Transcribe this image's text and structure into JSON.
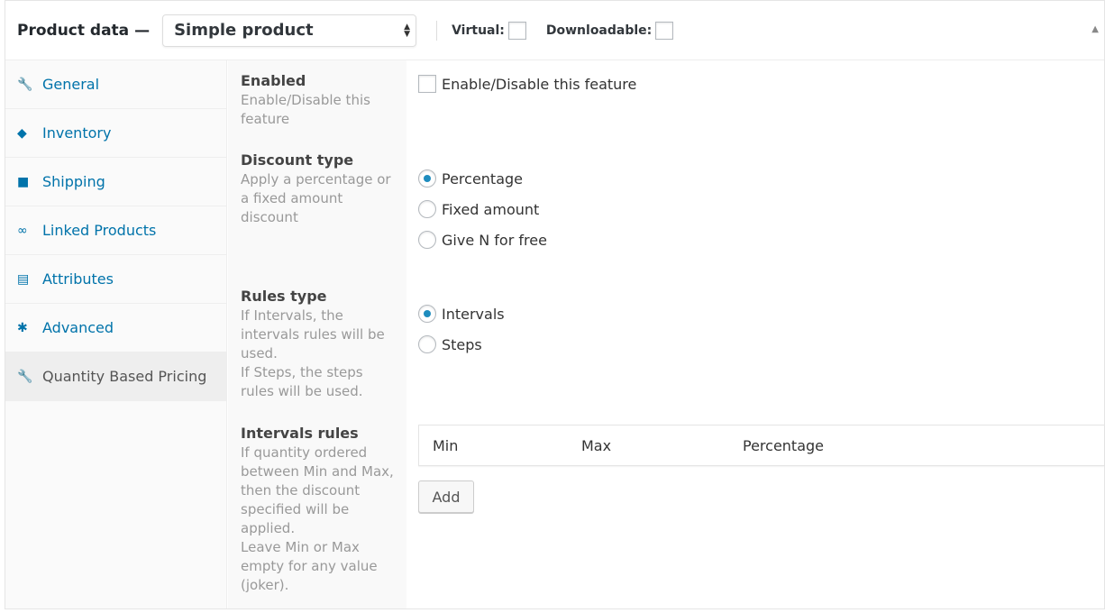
{
  "header": {
    "title": "Product data —",
    "product_type": "Simple product",
    "virtual_label": "Virtual:",
    "virtual_checked": false,
    "downloadable_label": "Downloadable:",
    "downloadable_checked": false
  },
  "sidebar": {
    "items": [
      {
        "label": "General",
        "icon": "wrench-icon",
        "glyph": "🔧"
      },
      {
        "label": "Inventory",
        "icon": "tag-icon",
        "glyph": "◆"
      },
      {
        "label": "Shipping",
        "icon": "truck-icon",
        "glyph": "■"
      },
      {
        "label": "Linked Products",
        "icon": "link-icon",
        "glyph": "∞"
      },
      {
        "label": "Attributes",
        "icon": "list-icon",
        "glyph": "▤"
      },
      {
        "label": "Advanced",
        "icon": "gear-icon",
        "glyph": "✱"
      },
      {
        "label": "Quantity Based Pricing",
        "icon": "wrench-icon",
        "glyph": "🔧",
        "active": true
      }
    ]
  },
  "fields": {
    "enabled": {
      "title": "Enabled",
      "desc": "Enable/Disable this feature",
      "option": "Enable/Disable this feature",
      "checked": false
    },
    "discount_type": {
      "title": "Discount type",
      "desc": "Apply a percentage or a fixed amount discount",
      "options": [
        "Percentage",
        "Fixed amount",
        "Give N for free"
      ],
      "selected": "Percentage"
    },
    "rules_type": {
      "title": "Rules type",
      "desc1": "If Intervals, the intervals rules will be used.",
      "desc2": "If Steps, the steps rules will be used.",
      "options": [
        "Intervals",
        "Steps"
      ],
      "selected": "Intervals"
    },
    "intervals_rules": {
      "title": "Intervals rules",
      "desc1": "If quantity ordered between Min and Max, then the discount specified will be applied.",
      "desc2": "Leave Min or Max empty for any value (joker).",
      "columns": [
        "Min",
        "Max",
        "Percentage"
      ],
      "add_label": "Add"
    }
  },
  "colors": {
    "link": "#0073aa",
    "radio_selected": "#1e8cbe"
  }
}
